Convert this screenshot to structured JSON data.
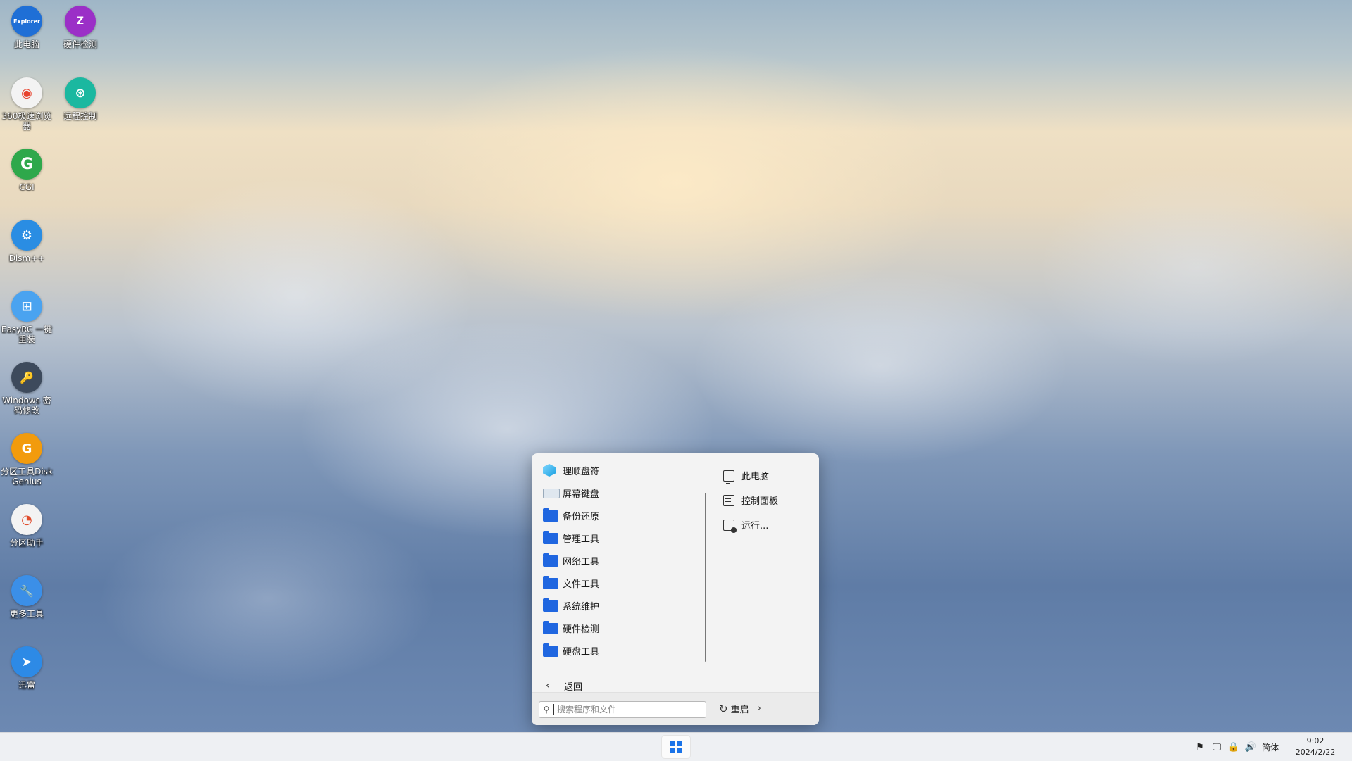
{
  "desktop": {
    "icons": [
      {
        "label": "此电脑",
        "glyph": "Explorer",
        "color": "#1f6fd6"
      },
      {
        "label": "硬件检测",
        "glyph": "Z",
        "color": "#9b2fc7"
      },
      {
        "label": "360极速浏览器",
        "glyph": "◉",
        "color": "#f3f3f3"
      },
      {
        "label": "远程控制",
        "glyph": "⊛",
        "color": "#1bb8a0"
      },
      {
        "label": "CGI",
        "glyph": "G",
        "color": "#2ea84b"
      },
      {
        "label": "Dism++",
        "glyph": "⚙",
        "color": "#2a8de3"
      },
      {
        "label": "EasyRC 一键重装",
        "glyph": "⊞",
        "color": "#4aa3f0"
      },
      {
        "label": "Windows 密码修改",
        "glyph": "🔑",
        "color": "#3d4a5c"
      },
      {
        "label": "分区工具DiskGenius",
        "glyph": "G",
        "color": "#f29b0d"
      },
      {
        "label": "分区助手",
        "glyph": "◔",
        "color": "#f3f3f3"
      },
      {
        "label": "更多工具",
        "glyph": "🔧",
        "color": "#3b8fe8"
      },
      {
        "label": "迅雷",
        "glyph": "➤",
        "color": "#2d8ae6"
      }
    ]
  },
  "start_menu": {
    "programs": [
      {
        "label": "理顺盘符",
        "icon": "cube-icon"
      },
      {
        "label": "屏幕键盘",
        "icon": "keyboard-icon"
      },
      {
        "label": "备份还原",
        "icon": "folder-icon"
      },
      {
        "label": "管理工具",
        "icon": "folder-icon"
      },
      {
        "label": "网络工具",
        "icon": "folder-icon"
      },
      {
        "label": "文件工具",
        "icon": "folder-icon"
      },
      {
        "label": "系统维护",
        "icon": "folder-icon"
      },
      {
        "label": "硬件检测",
        "icon": "folder-icon"
      },
      {
        "label": "硬盘工具",
        "icon": "folder-icon"
      }
    ],
    "back_label": "返回",
    "right_items": [
      {
        "label": "此电脑",
        "icon": "computer-icon"
      },
      {
        "label": "控制面板",
        "icon": "control-panel-icon"
      },
      {
        "label": "运行...",
        "icon": "run-icon"
      }
    ],
    "search_placeholder": "搜索程序和文件",
    "restart_label": "重启"
  },
  "taskbar": {
    "tray_lang": "简体",
    "time": "9:02",
    "date": "2024/2/22"
  }
}
